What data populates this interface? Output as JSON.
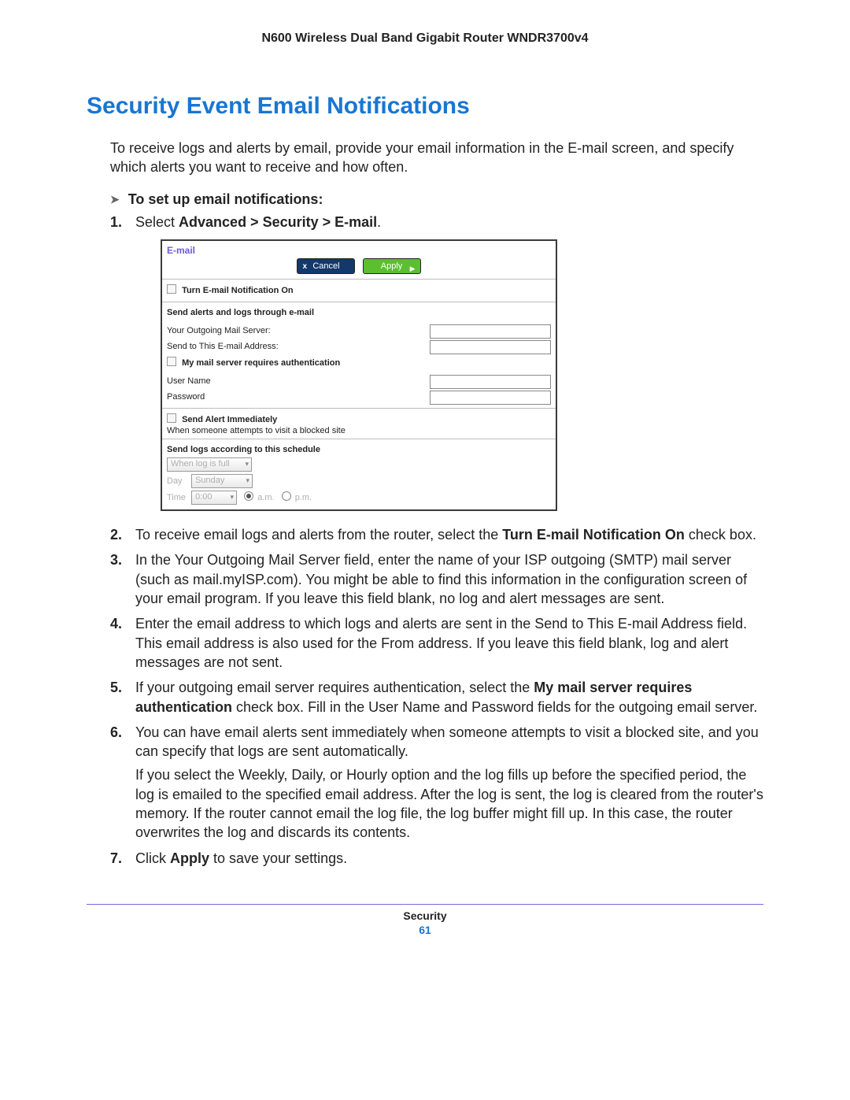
{
  "header": {
    "product": "N600 Wireless Dual Band Gigabit Router WNDR3700v4"
  },
  "section": {
    "title": "Security Event Email Notifications"
  },
  "intro": "To receive logs and alerts by email, provide your email information in the E-mail screen, and specify which alerts you want to receive and how often.",
  "procedure": {
    "heading": "To set up email notifications:"
  },
  "steps": {
    "s1_a": "Select ",
    "s1_b": "Advanced > Security > E-mail",
    "s1_c": ".",
    "s2_a": "To receive email logs and alerts from the router, select the ",
    "s2_b": "Turn E-mail Notification On",
    "s2_c": " check box.",
    "s3": "In the Your Outgoing Mail Server field, enter the name of your ISP outgoing (SMTP) mail server (such as mail.myISP.com). You might be able to find this information in the configuration screen of your email program. If you leave this field blank, no log and alert messages are sent.",
    "s4": "Enter the email address to which logs and alerts are sent in the Send to This E-mail Address field. This email address is also used for the From address. If you leave this field blank, log and alert messages are not sent.",
    "s5_a": "If your outgoing email server requires authentication, select the ",
    "s5_b": "My mail server requires authentication",
    "s5_c": " check box. Fill in the User Name and Password fields for the outgoing email server.",
    "s6_a": "You can have email alerts sent immediately when someone attempts to visit a blocked site, and you can specify that logs are sent automatically.",
    "s6_b": "If you select the Weekly, Daily, or Hourly option and the log fills up before the specified period, the log is emailed to the specified email address. After the log is sent, the log is cleared from the router's memory. If the router cannot email the log file, the log buffer might fill up. In this case, the router overwrites the log and discards its contents.",
    "s7_a": "Click ",
    "s7_b": "Apply",
    "s7_c": " to save your settings."
  },
  "panel": {
    "title": "E-mail",
    "buttons": {
      "cancel": "Cancel",
      "apply": "Apply"
    },
    "turn_on": "Turn E-mail Notification On",
    "sect_send": "Send alerts and logs through e-mail",
    "lbl_smtp": "Your Outgoing Mail Server:",
    "lbl_sendto": "Send to This E-mail Address:",
    "auth_cb": "My mail server requires authentication",
    "lbl_user": "User Name",
    "lbl_pass": "Password",
    "alert_cb": "Send Alert Immediately",
    "alert_sub": "When someone attempts to visit a blocked site",
    "sched_head": "Send logs according to this schedule",
    "sched_sel": "When log is full",
    "day_lbl": "Day",
    "day_val": "Sunday",
    "time_lbl": "Time",
    "time_val": "0:00",
    "am": "a.m.",
    "pm": "p.m."
  },
  "footer": {
    "section": "Security",
    "page": "61"
  }
}
